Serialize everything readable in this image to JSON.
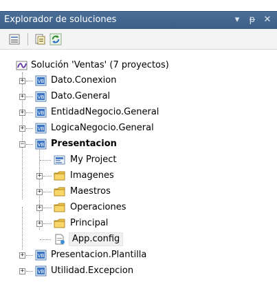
{
  "panel": {
    "title": "Explorador de soluciones",
    "controls": {
      "dropdown": "▾",
      "pin": "ᵽ",
      "close": "✕"
    }
  },
  "toolbar": {
    "buttons": [
      {
        "icon": "properties-icon"
      },
      {
        "icon": "show-all-files-icon"
      },
      {
        "icon": "refresh-icon"
      }
    ]
  },
  "tree": {
    "solution": "Solución 'Ventas'  (7 proyectos)",
    "projects": [
      {
        "label": "Dato.Conexion",
        "state": "+"
      },
      {
        "label": "Dato.General",
        "state": "+"
      },
      {
        "label": "EntidadNegocio.General",
        "state": "+"
      },
      {
        "label": "LogicaNegocio.General",
        "state": "+"
      },
      {
        "label": "Presentacion",
        "state": "−"
      },
      {
        "label": "Presentacion.Plantilla",
        "state": "+"
      },
      {
        "label": "Utilidad.Excepcion",
        "state": "+"
      }
    ],
    "presentacion_children": [
      {
        "label": "My Project"
      },
      {
        "label": "Imagenes",
        "state": "+"
      },
      {
        "label": "Maestros",
        "state": "+"
      },
      {
        "label": "Operaciones",
        "state": "+"
      },
      {
        "label": "Principal",
        "state": "+"
      },
      {
        "label": "App.config"
      }
    ]
  },
  "colors": {
    "titlebar": "#3c5d86",
    "folder": "#f3c64a",
    "vb_project": "#3a74c4",
    "selection": "#f0f0f0"
  }
}
